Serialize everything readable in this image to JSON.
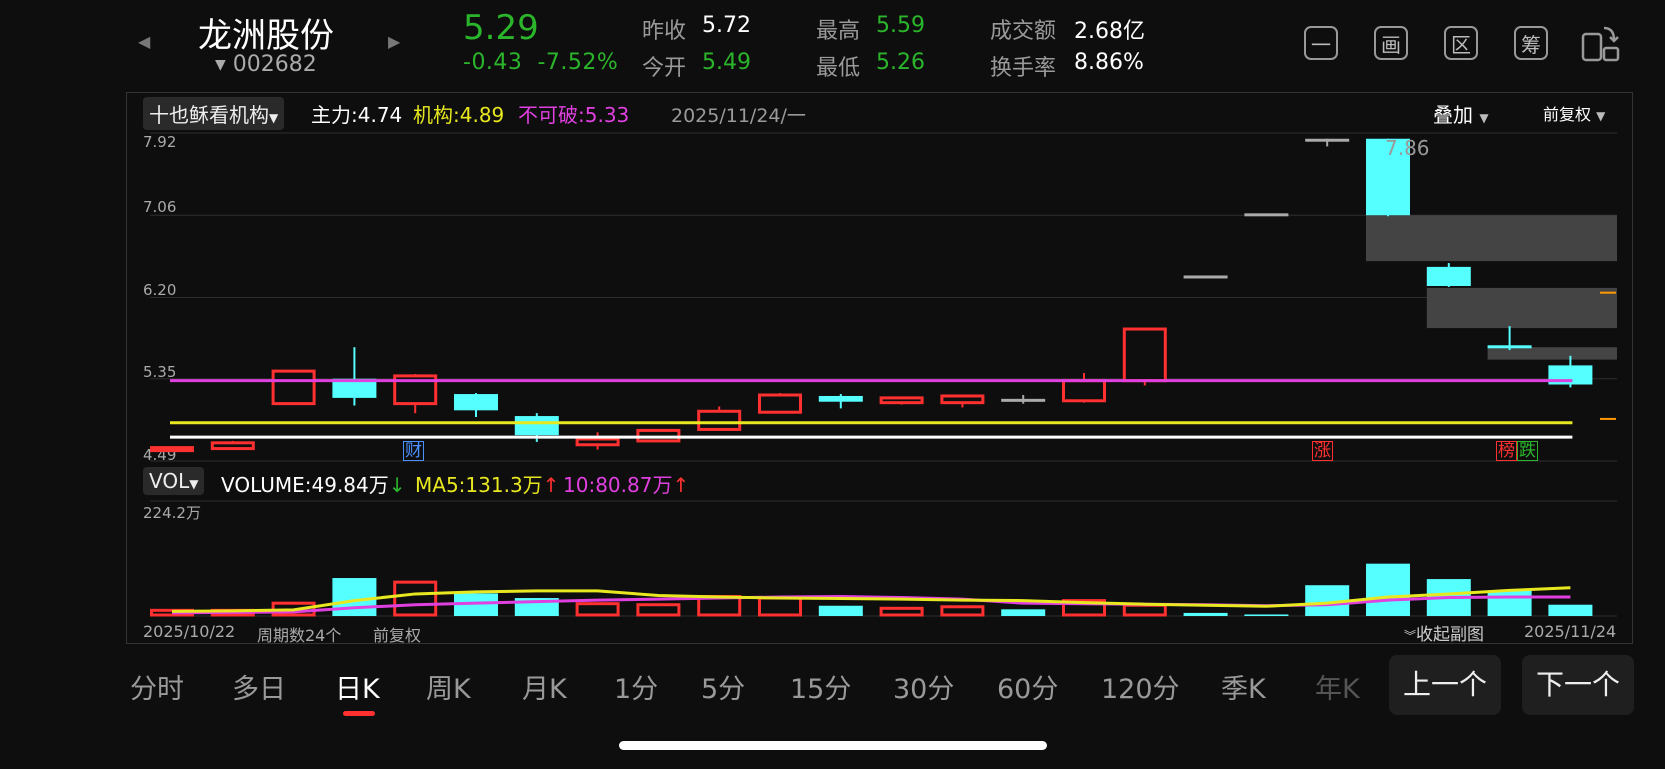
{
  "stock": {
    "name": "龙洲股份",
    "code": "002682",
    "price": "5.29",
    "change": "-0.43",
    "change_pct": "-7.52%"
  },
  "quote": {
    "prev_close_label": "昨收",
    "prev_close": "5.72",
    "open_label": "今开",
    "open": "5.49",
    "high_label": "最高",
    "high": "5.59",
    "low_label": "最低",
    "low": "5.26",
    "amount_label": "成交额",
    "amount": "2.68亿",
    "turnover_label": "换手率",
    "turnover": "8.86%"
  },
  "toolbar": {
    "btn1": "一",
    "btn2": "画",
    "btn3": "区",
    "btn4": "筹"
  },
  "main_chart": {
    "indicator": "十也稣看机构",
    "zhuli_label": "主力:",
    "zhuli": "4.74",
    "jigou_label": "机构:",
    "jigou": "4.89",
    "bukepo_label": "不可破:",
    "bukepo": "5.33",
    "date": "2025/11/24/一",
    "overlay": "叠加",
    "adjust": "前复权",
    "y_ticks": [
      "7.92",
      "7.06",
      "6.20",
      "5.35",
      "4.49"
    ],
    "peak_label": "7.86",
    "markers": {
      "cai": "财",
      "zhang": "涨",
      "bang": "榜",
      "die": "跌"
    }
  },
  "vol_chart": {
    "indicator": "VOL",
    "volume_label": "VOLUME:",
    "volume": "49.84万",
    "volume_arrow": "↓",
    "ma5_label": "MA5:",
    "ma5": "131.3万",
    "ma5_arrow": "↑",
    "ma10_label": "10:",
    "ma10": "80.87万",
    "ma10_arrow": "↑",
    "y_max": "224.2万"
  },
  "footer": {
    "start_date": "2025/10/22",
    "period": "周期数24个",
    "adjust": "前复权",
    "collapse": "收起副图",
    "end_date": "2025/11/24"
  },
  "tabs": [
    "分时",
    "多日",
    "日K",
    "周K",
    "月K",
    "1分",
    "5分",
    "15分",
    "30分",
    "60分",
    "120分",
    "季K",
    "年K"
  ],
  "active_tab": "日K",
  "nav": {
    "prev": "上一个",
    "next": "下一个"
  },
  "colors": {
    "up": "#ff3030",
    "down": "#55ffff",
    "flat": "#aaaaaa",
    "yellow": "#e8e820",
    "magenta": "#e040e0",
    "price_green": "#2bb52b"
  },
  "chart_data": {
    "type": "candlestick",
    "candles": [
      {
        "o": 4.62,
        "c": 4.63,
        "h": 4.64,
        "l": 4.62,
        "dir": "up"
      },
      {
        "o": 4.62,
        "c": 4.68,
        "h": 4.7,
        "l": 4.61,
        "dir": "up"
      },
      {
        "o": 5.09,
        "c": 5.43,
        "h": 5.43,
        "l": 5.08,
        "dir": "up"
      },
      {
        "o": 5.35,
        "c": 5.15,
        "h": 5.68,
        "l": 5.07,
        "dir": "down"
      },
      {
        "o": 5.09,
        "c": 5.38,
        "h": 5.4,
        "l": 4.99,
        "dir": "up"
      },
      {
        "o": 5.19,
        "c": 5.02,
        "h": 5.2,
        "l": 4.95,
        "dir": "down"
      },
      {
        "o": 4.96,
        "c": 4.76,
        "h": 4.99,
        "l": 4.69,
        "dir": "down"
      },
      {
        "o": 4.66,
        "c": 4.72,
        "h": 4.79,
        "l": 4.61,
        "dir": "up"
      },
      {
        "o": 4.7,
        "c": 4.81,
        "h": 4.82,
        "l": 4.7,
        "dir": "up"
      },
      {
        "o": 4.82,
        "c": 5.01,
        "h": 5.06,
        "l": 4.81,
        "dir": "up"
      },
      {
        "o": 5.0,
        "c": 5.18,
        "h": 5.2,
        "l": 4.99,
        "dir": "up"
      },
      {
        "o": 5.17,
        "c": 5.11,
        "h": 5.19,
        "l": 5.04,
        "dir": "down"
      },
      {
        "o": 5.1,
        "c": 5.15,
        "h": 5.16,
        "l": 5.08,
        "dir": "up"
      },
      {
        "o": 5.1,
        "c": 5.17,
        "h": 5.18,
        "l": 5.05,
        "dir": "up"
      },
      {
        "o": 5.14,
        "c": 5.14,
        "h": 5.18,
        "l": 5.09,
        "dir": "flat"
      },
      {
        "o": 5.12,
        "c": 5.33,
        "h": 5.41,
        "l": 5.1,
        "dir": "up"
      },
      {
        "o": 5.33,
        "c": 5.87,
        "h": 5.87,
        "l": 5.28,
        "dir": "up"
      },
      {
        "o": 6.43,
        "c": 6.43,
        "h": 6.43,
        "l": 6.43,
        "dir": "flat"
      },
      {
        "o": 7.08,
        "c": 7.08,
        "h": 7.08,
        "l": 7.08,
        "dir": "flat"
      },
      {
        "o": 7.86,
        "c": 7.86,
        "h": 7.86,
        "l": 7.78,
        "dir": "flat"
      },
      {
        "o": 7.86,
        "c": 7.06,
        "h": 7.86,
        "l": 7.05,
        "dir": "down"
      },
      {
        "o": 6.52,
        "c": 6.32,
        "h": 6.56,
        "l": 6.31,
        "dir": "down"
      },
      {
        "o": 5.7,
        "c": 5.7,
        "h": 5.9,
        "l": 5.65,
        "dir": "down"
      },
      {
        "o": 5.49,
        "c": 5.29,
        "h": 5.59,
        "l": 5.26,
        "dir": "down"
      }
    ],
    "volumes": [
      11,
      11,
      25,
      74,
      66,
      44,
      35,
      24,
      22,
      38,
      35,
      20,
      15,
      18,
      13,
      30,
      21,
      6,
      3,
      60,
      102,
      72,
      50,
      22
    ],
    "ma5": [
      9,
      10,
      12,
      30,
      43,
      47,
      49,
      49,
      40,
      37,
      35,
      34,
      33,
      31,
      30,
      26,
      23,
      21,
      19,
      25,
      37,
      43,
      50,
      55
    ],
    "ma10": [
      6,
      7,
      8,
      16,
      22,
      25,
      28,
      31,
      33,
      35,
      37,
      38,
      36,
      33,
      25,
      24,
      23,
      22,
      20,
      22,
      31,
      36,
      37,
      37
    ],
    "horizontal_lines": {
      "bukepo": 5.33,
      "jigou": 4.89,
      "zhuli": 4.74
    },
    "ylim": [
      4.49,
      7.92
    ],
    "vol_ylim": [
      0,
      224.2
    ],
    "zones": [
      {
        "from": 20,
        "top": 7.06,
        "bottom": 6.58
      },
      {
        "from": 21,
        "top": 6.3,
        "bottom": 5.88
      },
      {
        "from": 22,
        "top": 5.68,
        "bottom": 5.55
      }
    ],
    "marks": [
      6.25,
      4.93
    ]
  }
}
